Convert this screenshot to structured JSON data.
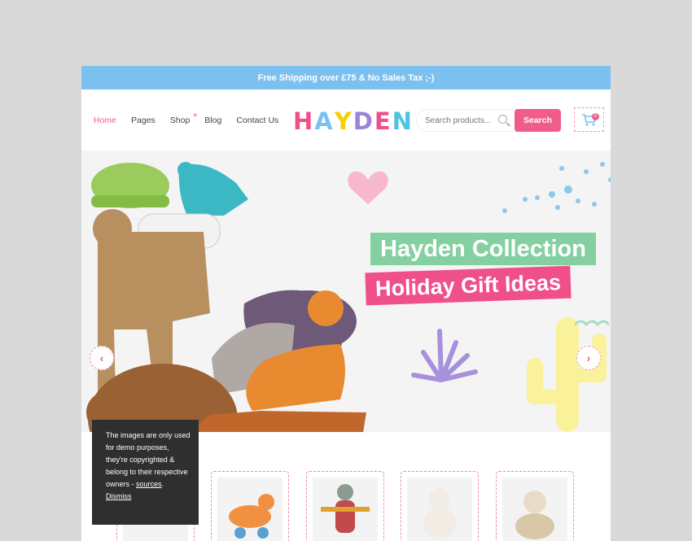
{
  "topbar": {
    "text": "Free Shipping over £75 & No Sales Tax ;-)"
  },
  "nav": [
    {
      "label": "Home"
    },
    {
      "label": "Pages"
    },
    {
      "label": "Shop"
    },
    {
      "label": "Blog"
    },
    {
      "label": "Contact Us"
    }
  ],
  "logo": {
    "letters": [
      "H",
      "A",
      "Y",
      "D",
      "E",
      "N"
    ],
    "colors": [
      "#f0508a",
      "#7cc0f0",
      "#f7d000",
      "#9b83d9",
      "#f0508a",
      "#4cc3e0"
    ]
  },
  "search": {
    "placeholder": "Search products...",
    "button_label": "Search"
  },
  "cart": {
    "count": "0"
  },
  "hero": {
    "title_line_1": "Hayden Collection",
    "title_line_2": "Holiday Gift Ideas",
    "prev_icon": "chevron-left-icon",
    "next_icon": "chevron-right-icon",
    "dots": [
      {
        "color": "#7cc0f0",
        "active": true
      },
      {
        "color": "#f05d8b",
        "active": false
      }
    ]
  },
  "cookie": {
    "text": "The images are only used for demo purposes, they're copyrighted & belong to their respective owners -",
    "link_label": "sources",
    "dismiss_label": "Dismiss"
  },
  "products": [
    {
      "name": "toy-card-1"
    },
    {
      "name": "toy-card-2"
    },
    {
      "name": "toy-card-3"
    },
    {
      "name": "toy-card-4"
    },
    {
      "name": "toy-card-5"
    }
  ],
  "colors": {
    "accent": "#f05d8b",
    "topbar": "#7cc0f0",
    "green": "#84d0a0"
  }
}
